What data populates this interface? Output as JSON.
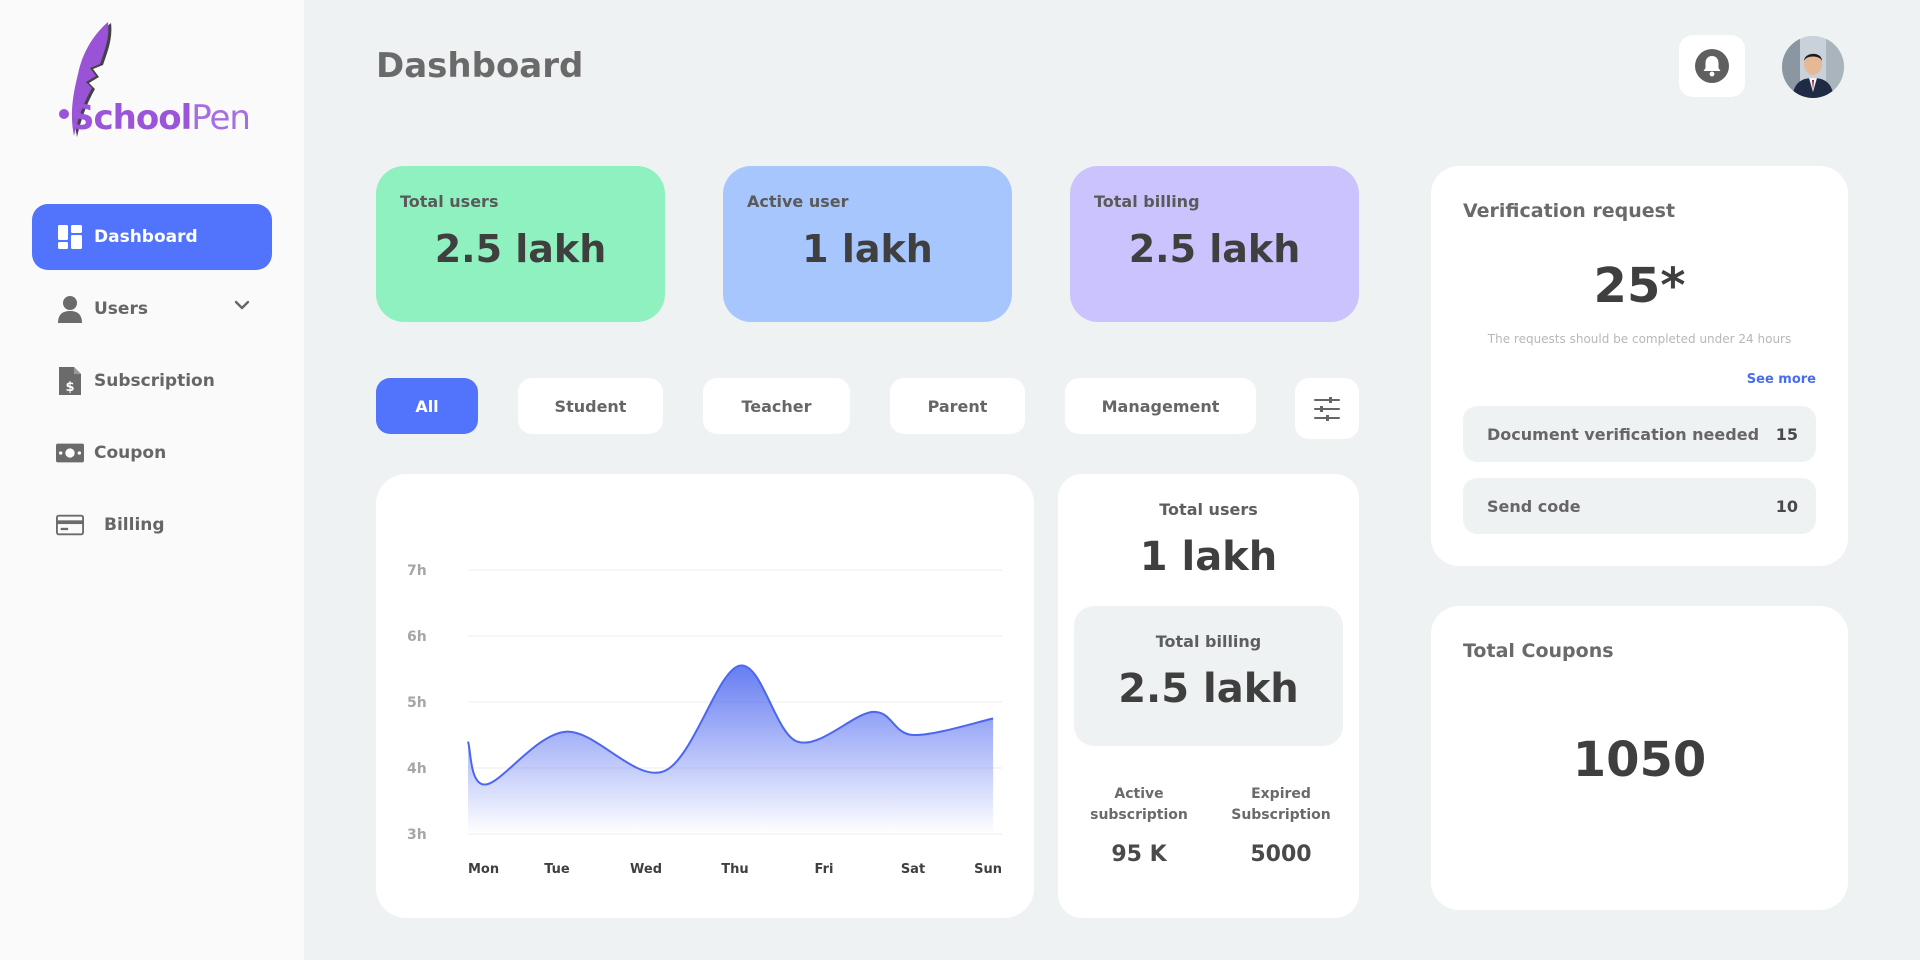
{
  "brand": {
    "name_bold": "School",
    "name_light": "Pen",
    "accent": "#9b55d8"
  },
  "sidebar": {
    "items": [
      {
        "label": "Dashboard",
        "icon": "dashboard-icon",
        "active": true
      },
      {
        "label": "Users",
        "icon": "user-icon",
        "expandable": true
      },
      {
        "label": "Subscription",
        "icon": "invoice-dollar-icon"
      },
      {
        "label": "Coupon",
        "icon": "money-icon"
      },
      {
        "label": "Billing",
        "icon": "credit-card-icon"
      }
    ]
  },
  "header": {
    "title": "Dashboard",
    "bell_icon": "bell-icon",
    "avatar": "user-avatar"
  },
  "stats": [
    {
      "label": "Total users",
      "value": "2.5 lakh",
      "color": "#90f1c0"
    },
    {
      "label": "Active user",
      "value": "1 lakh",
      "color": "#a6c6fd"
    },
    {
      "label": "Total billing",
      "value": "2.5 lakh",
      "color": "#cbc3fd"
    }
  ],
  "filters": {
    "items": [
      "All",
      "Student",
      "Teacher",
      "Parent",
      "Management"
    ],
    "selected": "All",
    "settings_icon": "sliders-icon",
    "accent": "#5273fb"
  },
  "chart_data": {
    "type": "area",
    "categories": [
      "Mon",
      "Tue",
      "Wed",
      "Thu",
      "Fri",
      "Sat",
      "Sun"
    ],
    "y_ticks": [
      "7h",
      "6h",
      "5h",
      "4h",
      "3h"
    ],
    "ylim": [
      3,
      7
    ],
    "x": [
      0,
      0.2,
      1.1,
      2.2,
      3.05,
      3.7,
      4.55,
      5.0,
      5.9
    ],
    "values": [
      4.4,
      3.75,
      4.55,
      3.95,
      5.55,
      4.4,
      4.85,
      4.5,
      4.75
    ],
    "color": "#4c66f0",
    "grid": true
  },
  "summary": {
    "total_users_label": "Total users",
    "total_users_value": "1 lakh",
    "total_billing_label": "Total billing",
    "total_billing_value": "2.5 lakh",
    "active_sub_label_1": "Active",
    "active_sub_label_2": "subscription",
    "active_sub_value": "95 K",
    "expired_sub_label_1": "Expired",
    "expired_sub_label_2": "Subscription",
    "expired_sub_value": "5000"
  },
  "verification": {
    "title": "Verification request",
    "count": "25*",
    "note": "The requests should be completed under 24 hours",
    "see_more": "See more",
    "rows": [
      {
        "label": "Document verification needed",
        "count": "15"
      },
      {
        "label": "Send code",
        "count": "10"
      }
    ]
  },
  "coupons": {
    "title": "Total Coupons",
    "value": "1050"
  }
}
